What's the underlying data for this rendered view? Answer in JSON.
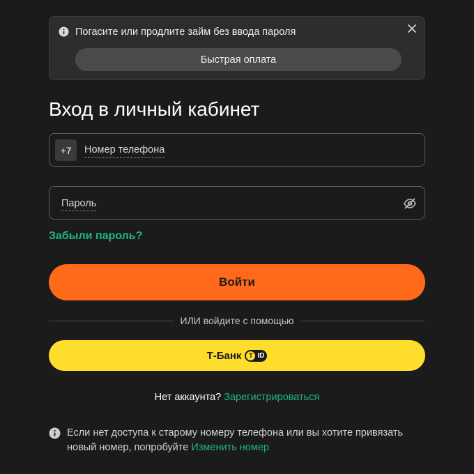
{
  "banner": {
    "text": "Погасите или продлите займ без ввода пароля",
    "button_label": "Быстрая оплата",
    "icons": {
      "info": "info-icon",
      "close": "close-icon"
    }
  },
  "login": {
    "title": "Вход в личный кабинет",
    "phone": {
      "country_code": "+7",
      "placeholder": "Номер телефона"
    },
    "password": {
      "placeholder": "Пароль",
      "toggle_icon": "eye-off-icon"
    },
    "forgot_label": "Забыли пароль?",
    "submit_label": "Войти",
    "divider_text": "ИЛИ войдите с помощью",
    "tbank": {
      "label": "Т-Банк",
      "badge_letter": "Т",
      "badge_text": "ID"
    }
  },
  "register": {
    "prompt": "Нет аккаунта?",
    "link_label": "Зарегистрироваться"
  },
  "footer": {
    "note": "Если нет доступа к старому номеру телефона или вы хотите привязать новый номер, попробуйте",
    "link_label": "Изменить номер",
    "icon": "info-icon"
  },
  "colors": {
    "background": "#1c1b1b",
    "accent_orange": "#ff6a1a",
    "tbank_yellow": "#ffdd2d",
    "link_green": "#1fb58a"
  }
}
